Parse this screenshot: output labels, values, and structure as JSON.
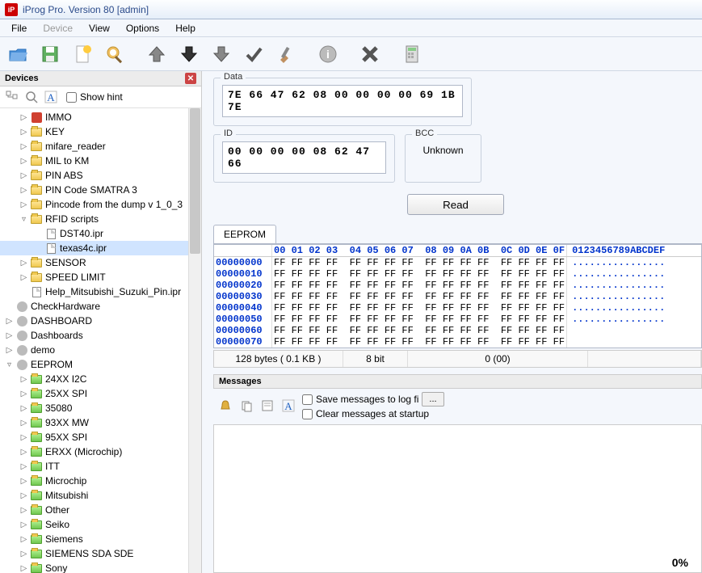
{
  "window": {
    "title": "iProg Pro. Version 80 [admin]",
    "app_badge": "iP"
  },
  "menu": {
    "file": "File",
    "device": "Device",
    "view": "View",
    "options": "Options",
    "help": "Help"
  },
  "devices_panel": {
    "title": "Devices",
    "show_hint": "Show hint",
    "items": [
      {
        "label": "IMMO",
        "depth": 1,
        "icon": "misc-red",
        "exp": "▷"
      },
      {
        "label": "KEY",
        "depth": 1,
        "icon": "folder",
        "exp": "▷"
      },
      {
        "label": "mifare_reader",
        "depth": 1,
        "icon": "folder",
        "exp": "▷"
      },
      {
        "label": "MIL to KM",
        "depth": 1,
        "icon": "folder",
        "exp": "▷"
      },
      {
        "label": "PIN ABS",
        "depth": 1,
        "icon": "folder",
        "exp": "▷"
      },
      {
        "label": "PIN Code SMATRA 3",
        "depth": 1,
        "icon": "folder",
        "exp": "▷"
      },
      {
        "label": "Pincode from the dump v 1_0_3",
        "depth": 1,
        "icon": "folder",
        "exp": "▷"
      },
      {
        "label": "RFID scripts",
        "depth": 1,
        "icon": "folder",
        "exp": "▿"
      },
      {
        "label": "DST40.ipr",
        "depth": 2,
        "icon": "file",
        "exp": ""
      },
      {
        "label": "texas4c.ipr",
        "depth": 2,
        "icon": "file",
        "exp": "",
        "selected": true
      },
      {
        "label": "SENSOR",
        "depth": 1,
        "icon": "folder",
        "exp": "▷"
      },
      {
        "label": "SPEED LIMIT",
        "depth": 1,
        "icon": "folder",
        "exp": "▷"
      },
      {
        "label": "Help_Mitsubishi_Suzuki_Pin.ipr",
        "depth": 1,
        "icon": "file",
        "exp": ""
      },
      {
        "label": "CheckHardware",
        "depth": 0,
        "icon": "misc-grey",
        "exp": ""
      },
      {
        "label": "DASHBOARD",
        "depth": 0,
        "icon": "misc-grey",
        "exp": "▷"
      },
      {
        "label": "Dashboards",
        "depth": 0,
        "icon": "misc-grey",
        "exp": "▷"
      },
      {
        "label": "demo",
        "depth": 0,
        "icon": "misc-grey",
        "exp": "▷"
      },
      {
        "label": "EEPROM",
        "depth": 0,
        "icon": "misc-grey",
        "exp": "▿"
      },
      {
        "label": "24XX I2C",
        "depth": 1,
        "icon": "folder-green",
        "exp": "▷"
      },
      {
        "label": "25XX SPI",
        "depth": 1,
        "icon": "folder-green",
        "exp": "▷"
      },
      {
        "label": "35080",
        "depth": 1,
        "icon": "folder-green",
        "exp": "▷"
      },
      {
        "label": "93XX MW",
        "depth": 1,
        "icon": "folder-green",
        "exp": "▷"
      },
      {
        "label": "95XX SPI",
        "depth": 1,
        "icon": "folder-green",
        "exp": "▷"
      },
      {
        "label": "ERXX (Microchip)",
        "depth": 1,
        "icon": "folder-green",
        "exp": "▷"
      },
      {
        "label": "ITT",
        "depth": 1,
        "icon": "folder-green",
        "exp": "▷"
      },
      {
        "label": "Microchip",
        "depth": 1,
        "icon": "folder-green",
        "exp": "▷"
      },
      {
        "label": "Mitsubishi",
        "depth": 1,
        "icon": "folder-green",
        "exp": "▷"
      },
      {
        "label": "Other",
        "depth": 1,
        "icon": "folder-green",
        "exp": "▷"
      },
      {
        "label": "Seiko",
        "depth": 1,
        "icon": "folder-green",
        "exp": "▷"
      },
      {
        "label": "Siemens",
        "depth": 1,
        "icon": "folder-green",
        "exp": "▷"
      },
      {
        "label": "SIEMENS SDA SDE",
        "depth": 1,
        "icon": "folder-green",
        "exp": "▷"
      },
      {
        "label": "Sony",
        "depth": 1,
        "icon": "folder-green",
        "exp": "▷"
      }
    ]
  },
  "fields": {
    "data_label": "Data",
    "data_value": "7E 66 47 62 08 00 00 00 00 69 1B 7E",
    "id_label": "ID",
    "id_value": "00 00 00 00 08 62 47 66",
    "bcc_label": "BCC",
    "bcc_value": "Unknown",
    "read_btn": "Read"
  },
  "hex": {
    "tab": "EEPROM",
    "cols": [
      "00",
      "01",
      "02",
      "03",
      "04",
      "05",
      "06",
      "07",
      "08",
      "09",
      "0A",
      "0B",
      "0C",
      "0D",
      "0E",
      "0F"
    ],
    "ascii_hdr": "0123456789ABCDEF",
    "rows": [
      {
        "addr": "00000000",
        "bytes": [
          "FF",
          "FF",
          "FF",
          "FF",
          "FF",
          "FF",
          "FF",
          "FF",
          "FF",
          "FF",
          "FF",
          "FF",
          "FF",
          "FF",
          "FF",
          "FF"
        ],
        "ascii": "................"
      },
      {
        "addr": "00000010",
        "bytes": [
          "FF",
          "FF",
          "FF",
          "FF",
          "FF",
          "FF",
          "FF",
          "FF",
          "FF",
          "FF",
          "FF",
          "FF",
          "FF",
          "FF",
          "FF",
          "FF"
        ],
        "ascii": "................"
      },
      {
        "addr": "00000020",
        "bytes": [
          "FF",
          "FF",
          "FF",
          "FF",
          "FF",
          "FF",
          "FF",
          "FF",
          "FF",
          "FF",
          "FF",
          "FF",
          "FF",
          "FF",
          "FF",
          "FF"
        ],
        "ascii": "................"
      },
      {
        "addr": "00000030",
        "bytes": [
          "FF",
          "FF",
          "FF",
          "FF",
          "FF",
          "FF",
          "FF",
          "FF",
          "FF",
          "FF",
          "FF",
          "FF",
          "FF",
          "FF",
          "FF",
          "FF"
        ],
        "ascii": "................"
      },
      {
        "addr": "00000040",
        "bytes": [
          "FF",
          "FF",
          "FF",
          "FF",
          "FF",
          "FF",
          "FF",
          "FF",
          "FF",
          "FF",
          "FF",
          "FF",
          "FF",
          "FF",
          "FF",
          "FF"
        ],
        "ascii": "................"
      },
      {
        "addr": "00000050",
        "bytes": [
          "FF",
          "FF",
          "FF",
          "FF",
          "FF",
          "FF",
          "FF",
          "FF",
          "FF",
          "FF",
          "FF",
          "FF",
          "FF",
          "FF",
          "FF",
          "FF"
        ],
        "ascii": "................"
      },
      {
        "addr": "00000060",
        "bytes": [
          "FF",
          "FF",
          "FF",
          "FF",
          "FF",
          "FF",
          "FF",
          "FF",
          "FF",
          "FF",
          "FF",
          "FF",
          "FF",
          "FF",
          "FF",
          "FF"
        ],
        "ascii": ""
      },
      {
        "addr": "00000070",
        "bytes": [
          "FF",
          "FF",
          "FF",
          "FF",
          "FF",
          "FF",
          "FF",
          "FF",
          "FF",
          "FF",
          "FF",
          "FF",
          "FF",
          "FF",
          "FF",
          "FF"
        ],
        "ascii": ""
      }
    ],
    "status": {
      "size": "128 bytes ( 0.1 KB )",
      "bits": "8 bit",
      "pos": "0 (00)"
    }
  },
  "messages": {
    "title": "Messages",
    "save_log": "Save messages to log fi",
    "clear_startup": "Clear messages at startup",
    "progress": "0%"
  }
}
